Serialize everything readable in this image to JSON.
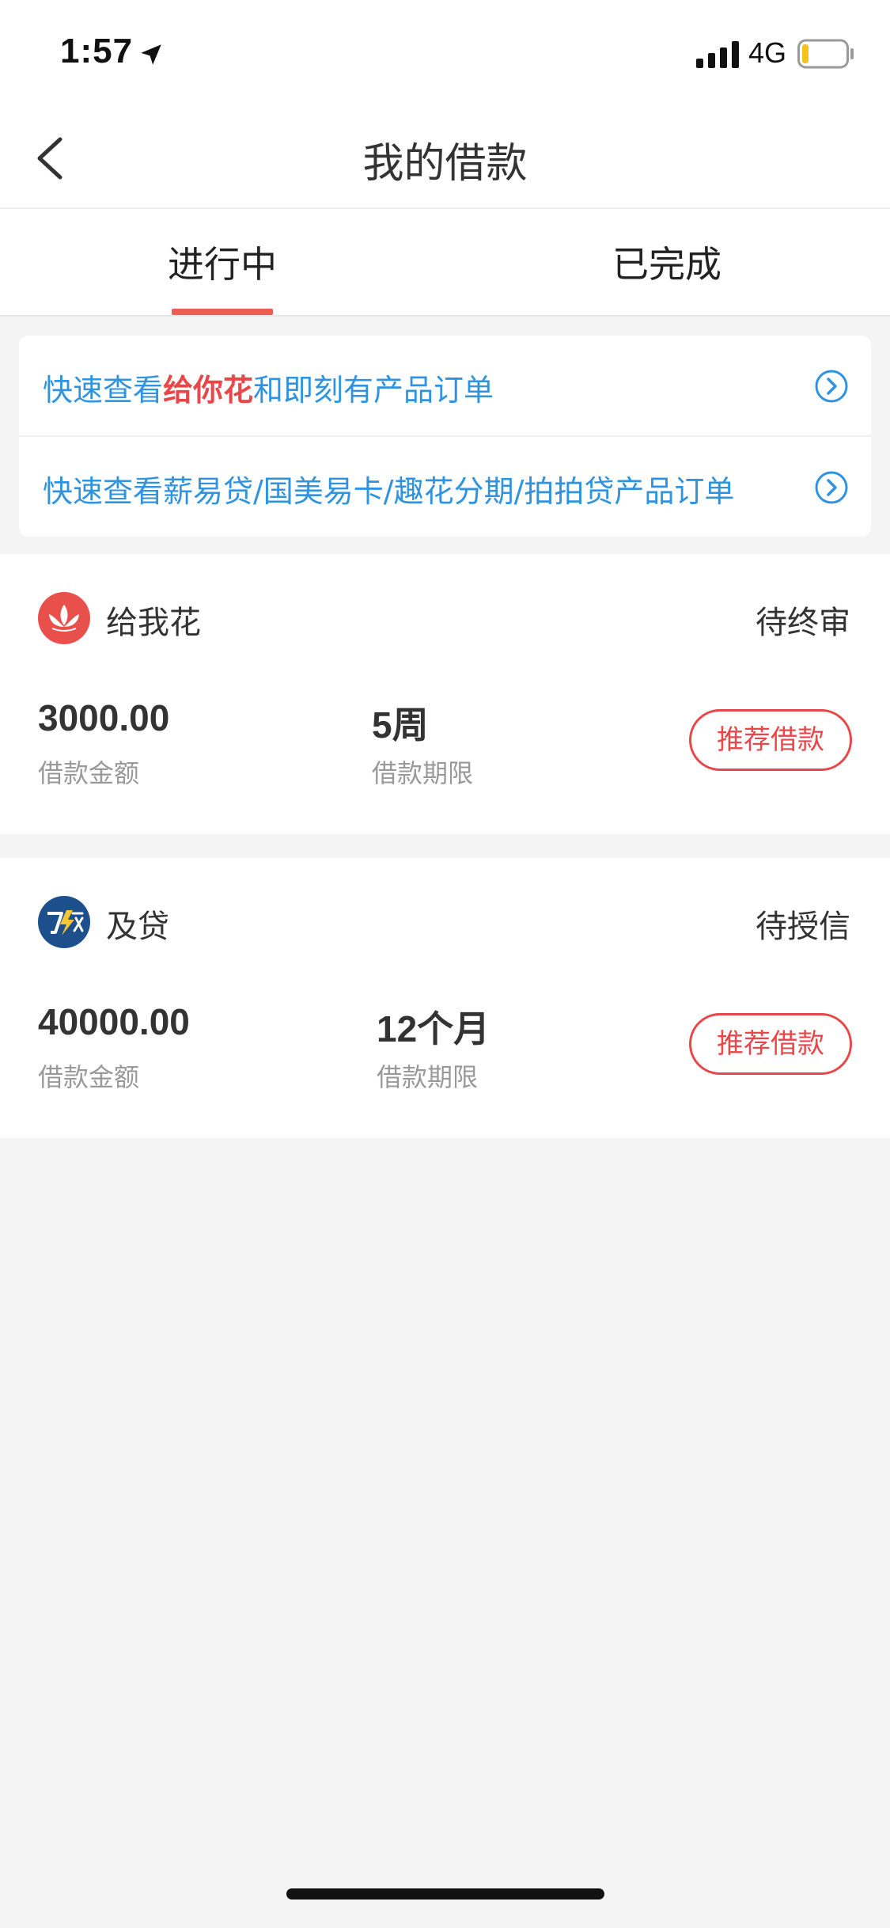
{
  "status_bar": {
    "time": "1:57",
    "network": "4G",
    "icons": [
      "location-arrow-icon",
      "signal-icon",
      "battery-icon"
    ]
  },
  "nav": {
    "title": "我的借款",
    "back_icon": "chevron-left-icon"
  },
  "tabs": [
    {
      "label": "进行中",
      "active": true
    },
    {
      "label": "已完成",
      "active": false
    }
  ],
  "quick_links": [
    {
      "prefix": "快速查看",
      "highlight": "给你花",
      "suffix": "和即刻有产品订单"
    },
    {
      "prefix": "快速查看薪易贷/国美易卡/趣花分期/拍拍贷产品订单",
      "highlight": "",
      "suffix": ""
    }
  ],
  "loans": [
    {
      "product": "给我花",
      "status": "待终审",
      "amount": "3000.00",
      "amount_label": "借款金额",
      "term": "5周",
      "term_label": "借款期限",
      "button": "推荐借款"
    },
    {
      "product": "及贷",
      "status": "待授信",
      "amount": "40000.00",
      "amount_label": "借款金额",
      "term": "12个月",
      "term_label": "借款期限",
      "button": "推荐借款"
    }
  ],
  "colors": {
    "accent_red": "#e8474a",
    "link_blue": "#2f93e0",
    "background": "#f4f4f4"
  }
}
